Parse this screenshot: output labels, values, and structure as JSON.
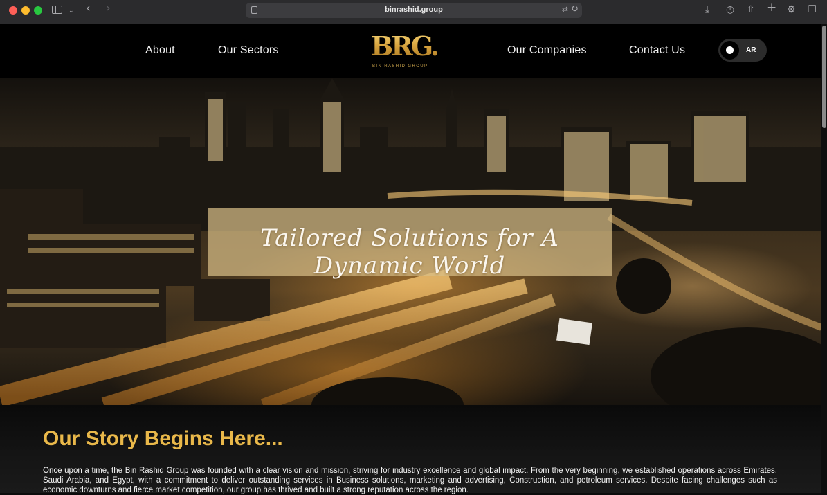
{
  "browser": {
    "url": "binrashid.group"
  },
  "nav": {
    "about": "About",
    "sectors": "Our Sectors",
    "companies": "Our Companies",
    "contact": "Contact Us",
    "lang_toggle": "AR"
  },
  "logo": {
    "mark": "BRG.",
    "subtitle": "BIN RASHID GROUP"
  },
  "hero": {
    "tagline": "Tailored Solutions for A Dynamic World"
  },
  "story": {
    "title": "Our Story Begins Here...",
    "text": "Once upon a time, the Bin Rashid Group was founded with a clear vision and mission, striving for industry excellence and global impact. From the very beginning, we established operations across Emirates, Saudi Arabia, and Egypt, with a commitment to deliver outstanding services in Business solutions, marketing and advertising, Construction, and petroleum services. Despite facing challenges such as economic downturns and fierce market competition, our group has thrived and built a strong reputation across the region."
  },
  "colors": {
    "accent_gold": "#e9b84a",
    "nav_bg": "#000000",
    "tagline_box": "#d8be87"
  }
}
